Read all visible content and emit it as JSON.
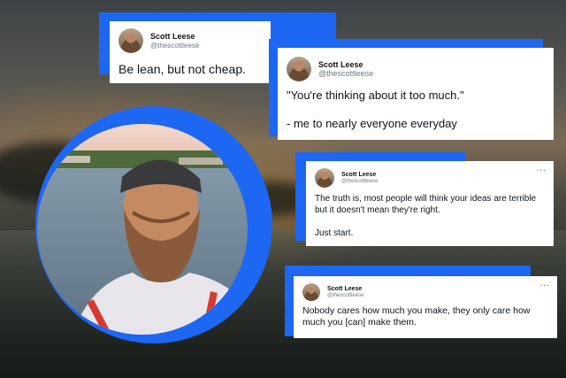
{
  "tweets": [
    {
      "name": "Scott Leese",
      "handle": "@thescottleese",
      "text": "Be lean, but not cheap."
    },
    {
      "name": "Scott Leese",
      "handle": "@thescottleese",
      "text": "\"You're thinking about it too much.\"\n\n- me to nearly everyone everyday"
    },
    {
      "name": "Scott Leese",
      "handle": "@thescottleese",
      "more": "···",
      "text": "The truth is, most people will think your ideas are terrible but it doesn't mean they're right.\n\nJust start."
    },
    {
      "name": "Scott Leese",
      "handle": "@thescottleese",
      "more": "···",
      "text": "Nobody cares how much you make, they only care how much you [can] make them."
    }
  ],
  "colors": {
    "accent": "#1d67f2",
    "card": "#ffffff",
    "handle": "#6b7a86"
  }
}
